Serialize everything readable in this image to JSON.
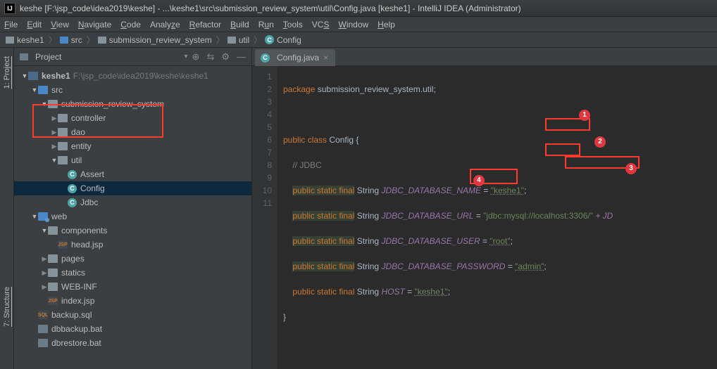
{
  "title": "keshe [F:\\jsp_code\\idea2019\\keshe] - ...\\keshe1\\src\\submission_review_system\\util\\Config.java [keshe1] - IntelliJ IDEA (Administrator)",
  "menu": [
    "File",
    "Edit",
    "View",
    "Navigate",
    "Code",
    "Analyze",
    "Refactor",
    "Build",
    "Run",
    "Tools",
    "VCS",
    "Window",
    "Help"
  ],
  "breadcrumbs": [
    "keshe1",
    "src",
    "submission_review_system",
    "util",
    "Config"
  ],
  "side_tabs": {
    "project": "1: Project",
    "structure": "7: Structure"
  },
  "panel": {
    "title": "Project",
    "icons": [
      "target",
      "gear",
      "hide"
    ]
  },
  "tree": {
    "root": {
      "name": "keshe1",
      "path": "F:\\jsp_code\\idea2019\\keshe\\keshe1"
    },
    "src": "src",
    "pkg": "submission_review_system",
    "controller": "controller",
    "dao": "dao",
    "entity": "entity",
    "util": "util",
    "assert": "Assert",
    "config": "Config",
    "jdbc": "Jdbc",
    "web": "web",
    "components": "components",
    "headjsp": "head.jsp",
    "pages": "pages",
    "statics": "statics",
    "webinf": "WEB-INF",
    "indexjsp": "index.jsp",
    "backupsql": "backup.sql",
    "dbbackup": "dbbackup.bat",
    "dbrestore": "dbrestore.bat"
  },
  "editor": {
    "tab": "Config.java",
    "lines": [
      "1",
      "2",
      "3",
      "4",
      "5",
      "6",
      "7",
      "8",
      "9",
      "10",
      "11"
    ],
    "code": {
      "l1_pkg": "package",
      "l1_name": "submission_review_system.util",
      "l3_public": "public",
      "l3_class": "class",
      "l3_name": "Config",
      "l4_cmt": "// JDBC",
      "l5_mods": "public static final",
      "l5_type": "String",
      "l5_var": "JDBC_DATABASE_NAME",
      "l5_val": "\"keshe1\"",
      "l6_mods": "public static final",
      "l6_type": "String",
      "l6_var": "JDBC_DATABASE_URL",
      "l6_val": "\"jdbc:mysql://localhost:3306/\"",
      "l6_plus": " + JD",
      "l7_mods": "public static final",
      "l7_type": "String",
      "l7_var": "JDBC_DATABASE_USER",
      "l7_val": "\"root\"",
      "l8_mods": "public static final",
      "l8_type": "String",
      "l8_var": "JDBC_DATABASE_PASSWORD",
      "l8_val": "\"admin\"",
      "l9_mods": "public static final",
      "l9_type": "String",
      "l9_var": "HOST",
      "l9_val": "\"keshe1\""
    }
  },
  "badges": {
    "b1": "1",
    "b2": "2",
    "b3": "3",
    "b4": "4"
  }
}
